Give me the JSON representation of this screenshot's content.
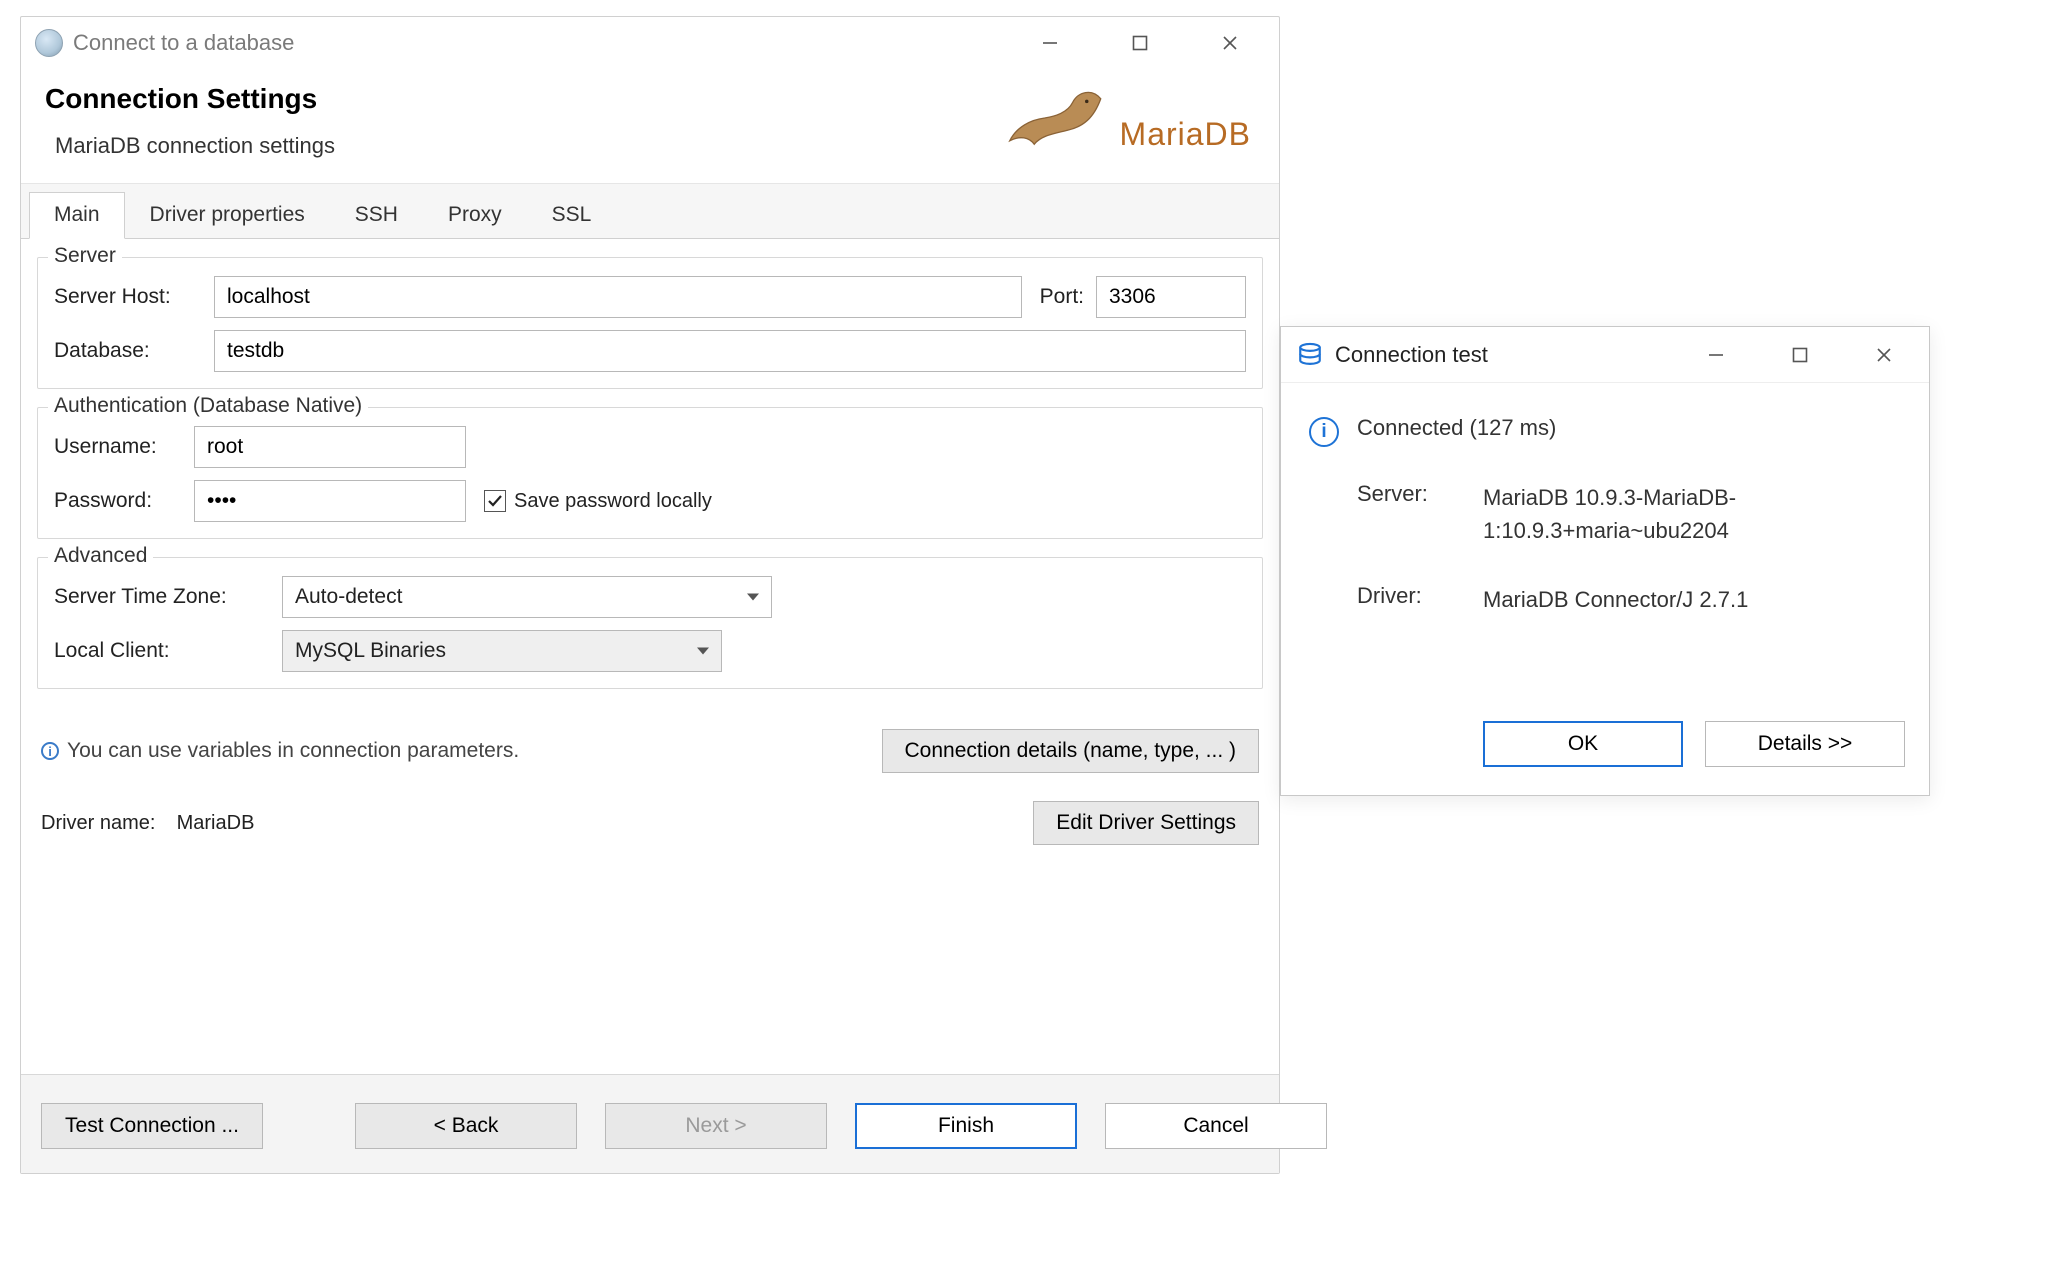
{
  "mainWindow": {
    "title": "Connect to a database",
    "heading": "Connection Settings",
    "subheading": "MariaDB connection settings",
    "brand": "MariaDB"
  },
  "tabs": [
    "Main",
    "Driver properties",
    "SSH",
    "Proxy",
    "SSL"
  ],
  "activeTab": "Main",
  "server": {
    "legend": "Server",
    "hostLabel": "Server Host:",
    "host": "localhost",
    "portLabel": "Port:",
    "port": "3306",
    "databaseLabel": "Database:",
    "database": "testdb"
  },
  "auth": {
    "legend": "Authentication (Database Native)",
    "usernameLabel": "Username:",
    "username": "root",
    "passwordLabel": "Password:",
    "password": "••••",
    "savePw": true,
    "savePwLabel": "Save password locally"
  },
  "advanced": {
    "legend": "Advanced",
    "tzLabel": "Server Time Zone:",
    "tz": "Auto-detect",
    "clientLabel": "Local Client:",
    "client": "MySQL Binaries"
  },
  "hintText": "You can use variables in connection parameters.",
  "connDetailsBtn": "Connection details (name, type, ... )",
  "driverNameLabel": "Driver name:",
  "driverName": "MariaDB",
  "editDriverBtn": "Edit Driver Settings",
  "footer": {
    "test": "Test Connection ...",
    "back": "< Back",
    "next": "Next >",
    "finish": "Finish",
    "cancel": "Cancel"
  },
  "testDialog": {
    "title": "Connection test",
    "message": "Connected (127 ms)",
    "serverLabel": "Server:",
    "serverValue": "MariaDB 10.9.3-MariaDB-1:10.9.3+maria~ubu2204",
    "driverLabel": "Driver:",
    "driverValue": "MariaDB Connector/J 2.7.1",
    "ok": "OK",
    "details": "Details >>"
  }
}
